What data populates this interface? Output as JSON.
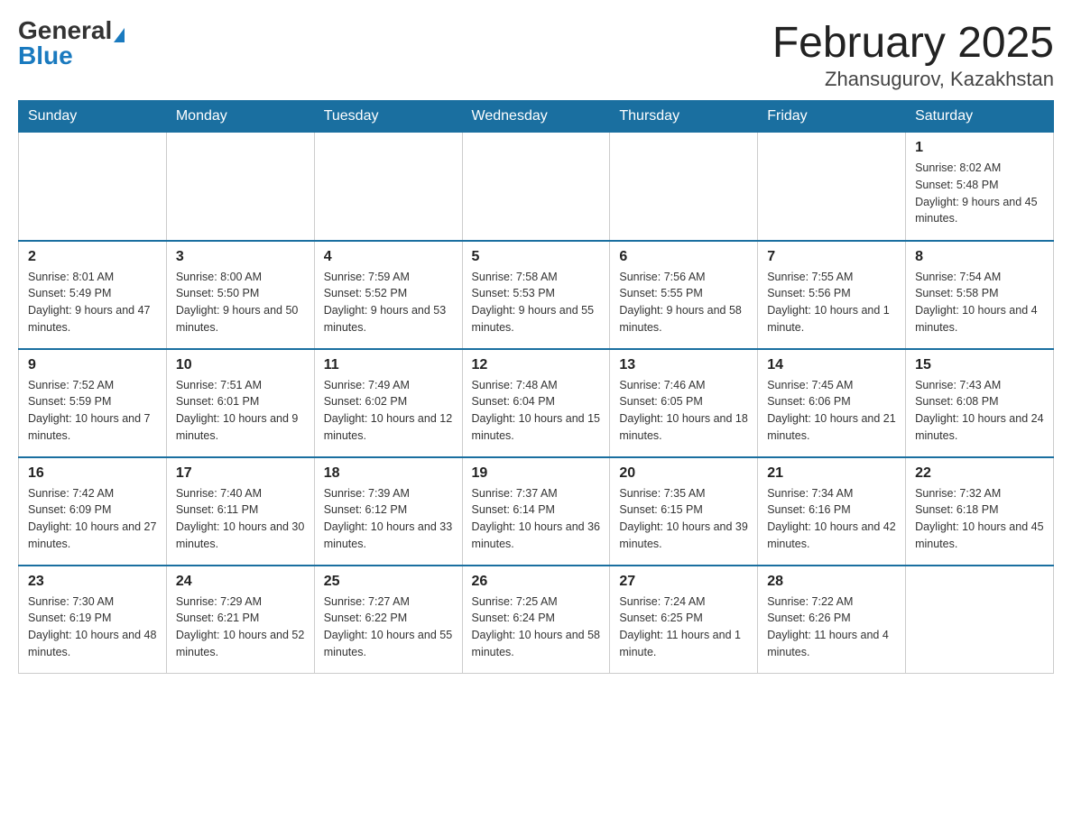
{
  "header": {
    "logo_general": "General",
    "logo_blue": "Blue",
    "month_title": "February 2025",
    "location": "Zhansugurov, Kazakhstan"
  },
  "weekdays": [
    "Sunday",
    "Monday",
    "Tuesday",
    "Wednesday",
    "Thursday",
    "Friday",
    "Saturday"
  ],
  "weeks": [
    [
      {
        "day": "",
        "info": ""
      },
      {
        "day": "",
        "info": ""
      },
      {
        "day": "",
        "info": ""
      },
      {
        "day": "",
        "info": ""
      },
      {
        "day": "",
        "info": ""
      },
      {
        "day": "",
        "info": ""
      },
      {
        "day": "1",
        "info": "Sunrise: 8:02 AM\nSunset: 5:48 PM\nDaylight: 9 hours and 45 minutes."
      }
    ],
    [
      {
        "day": "2",
        "info": "Sunrise: 8:01 AM\nSunset: 5:49 PM\nDaylight: 9 hours and 47 minutes."
      },
      {
        "day": "3",
        "info": "Sunrise: 8:00 AM\nSunset: 5:50 PM\nDaylight: 9 hours and 50 minutes."
      },
      {
        "day": "4",
        "info": "Sunrise: 7:59 AM\nSunset: 5:52 PM\nDaylight: 9 hours and 53 minutes."
      },
      {
        "day": "5",
        "info": "Sunrise: 7:58 AM\nSunset: 5:53 PM\nDaylight: 9 hours and 55 minutes."
      },
      {
        "day": "6",
        "info": "Sunrise: 7:56 AM\nSunset: 5:55 PM\nDaylight: 9 hours and 58 minutes."
      },
      {
        "day": "7",
        "info": "Sunrise: 7:55 AM\nSunset: 5:56 PM\nDaylight: 10 hours and 1 minute."
      },
      {
        "day": "8",
        "info": "Sunrise: 7:54 AM\nSunset: 5:58 PM\nDaylight: 10 hours and 4 minutes."
      }
    ],
    [
      {
        "day": "9",
        "info": "Sunrise: 7:52 AM\nSunset: 5:59 PM\nDaylight: 10 hours and 7 minutes."
      },
      {
        "day": "10",
        "info": "Sunrise: 7:51 AM\nSunset: 6:01 PM\nDaylight: 10 hours and 9 minutes."
      },
      {
        "day": "11",
        "info": "Sunrise: 7:49 AM\nSunset: 6:02 PM\nDaylight: 10 hours and 12 minutes."
      },
      {
        "day": "12",
        "info": "Sunrise: 7:48 AM\nSunset: 6:04 PM\nDaylight: 10 hours and 15 minutes."
      },
      {
        "day": "13",
        "info": "Sunrise: 7:46 AM\nSunset: 6:05 PM\nDaylight: 10 hours and 18 minutes."
      },
      {
        "day": "14",
        "info": "Sunrise: 7:45 AM\nSunset: 6:06 PM\nDaylight: 10 hours and 21 minutes."
      },
      {
        "day": "15",
        "info": "Sunrise: 7:43 AM\nSunset: 6:08 PM\nDaylight: 10 hours and 24 minutes."
      }
    ],
    [
      {
        "day": "16",
        "info": "Sunrise: 7:42 AM\nSunset: 6:09 PM\nDaylight: 10 hours and 27 minutes."
      },
      {
        "day": "17",
        "info": "Sunrise: 7:40 AM\nSunset: 6:11 PM\nDaylight: 10 hours and 30 minutes."
      },
      {
        "day": "18",
        "info": "Sunrise: 7:39 AM\nSunset: 6:12 PM\nDaylight: 10 hours and 33 minutes."
      },
      {
        "day": "19",
        "info": "Sunrise: 7:37 AM\nSunset: 6:14 PM\nDaylight: 10 hours and 36 minutes."
      },
      {
        "day": "20",
        "info": "Sunrise: 7:35 AM\nSunset: 6:15 PM\nDaylight: 10 hours and 39 minutes."
      },
      {
        "day": "21",
        "info": "Sunrise: 7:34 AM\nSunset: 6:16 PM\nDaylight: 10 hours and 42 minutes."
      },
      {
        "day": "22",
        "info": "Sunrise: 7:32 AM\nSunset: 6:18 PM\nDaylight: 10 hours and 45 minutes."
      }
    ],
    [
      {
        "day": "23",
        "info": "Sunrise: 7:30 AM\nSunset: 6:19 PM\nDaylight: 10 hours and 48 minutes."
      },
      {
        "day": "24",
        "info": "Sunrise: 7:29 AM\nSunset: 6:21 PM\nDaylight: 10 hours and 52 minutes."
      },
      {
        "day": "25",
        "info": "Sunrise: 7:27 AM\nSunset: 6:22 PM\nDaylight: 10 hours and 55 minutes."
      },
      {
        "day": "26",
        "info": "Sunrise: 7:25 AM\nSunset: 6:24 PM\nDaylight: 10 hours and 58 minutes."
      },
      {
        "day": "27",
        "info": "Sunrise: 7:24 AM\nSunset: 6:25 PM\nDaylight: 11 hours and 1 minute."
      },
      {
        "day": "28",
        "info": "Sunrise: 7:22 AM\nSunset: 6:26 PM\nDaylight: 11 hours and 4 minutes."
      },
      {
        "day": "",
        "info": ""
      }
    ]
  ]
}
